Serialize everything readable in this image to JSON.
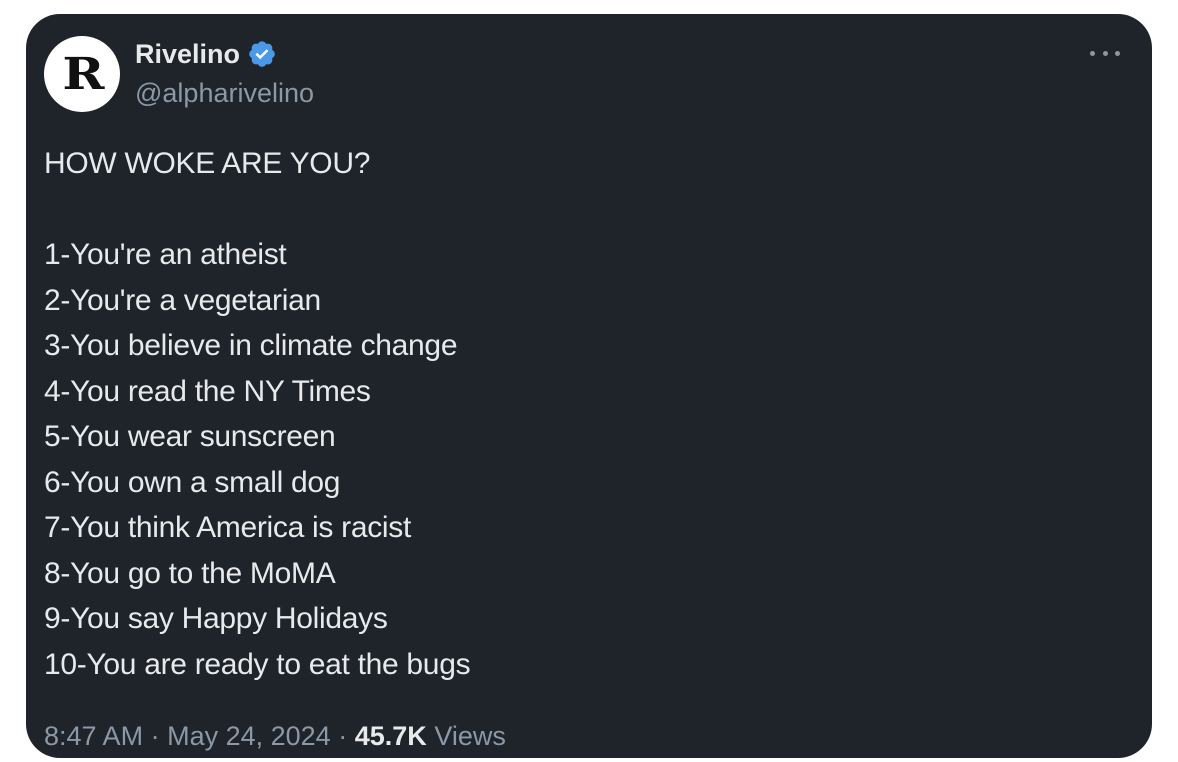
{
  "author": {
    "avatar_letter": "R",
    "name": "Rivelino",
    "handle": "@alpharivelino",
    "verified_color": "#4a99e9"
  },
  "tweet": {
    "heading": "HOW WOKE ARE YOU?",
    "items": [
      "1-You're an atheist",
      "2-You're a vegetarian",
      "3-You believe in climate change",
      "4-You read the NY Times",
      "5-You wear sunscreen",
      "6-You own a small dog",
      "7-You think America is racist",
      "8-You go to the MoMA",
      "9-You say Happy Holidays",
      "10-You are ready to eat the bugs"
    ]
  },
  "meta": {
    "time": "8:47 AM",
    "separator": "·",
    "date": "May 24, 2024",
    "views_count": "45.7K",
    "views_label": "Views"
  },
  "icons": {
    "verified": "verified-badge-icon",
    "more": "more-options-icon"
  }
}
